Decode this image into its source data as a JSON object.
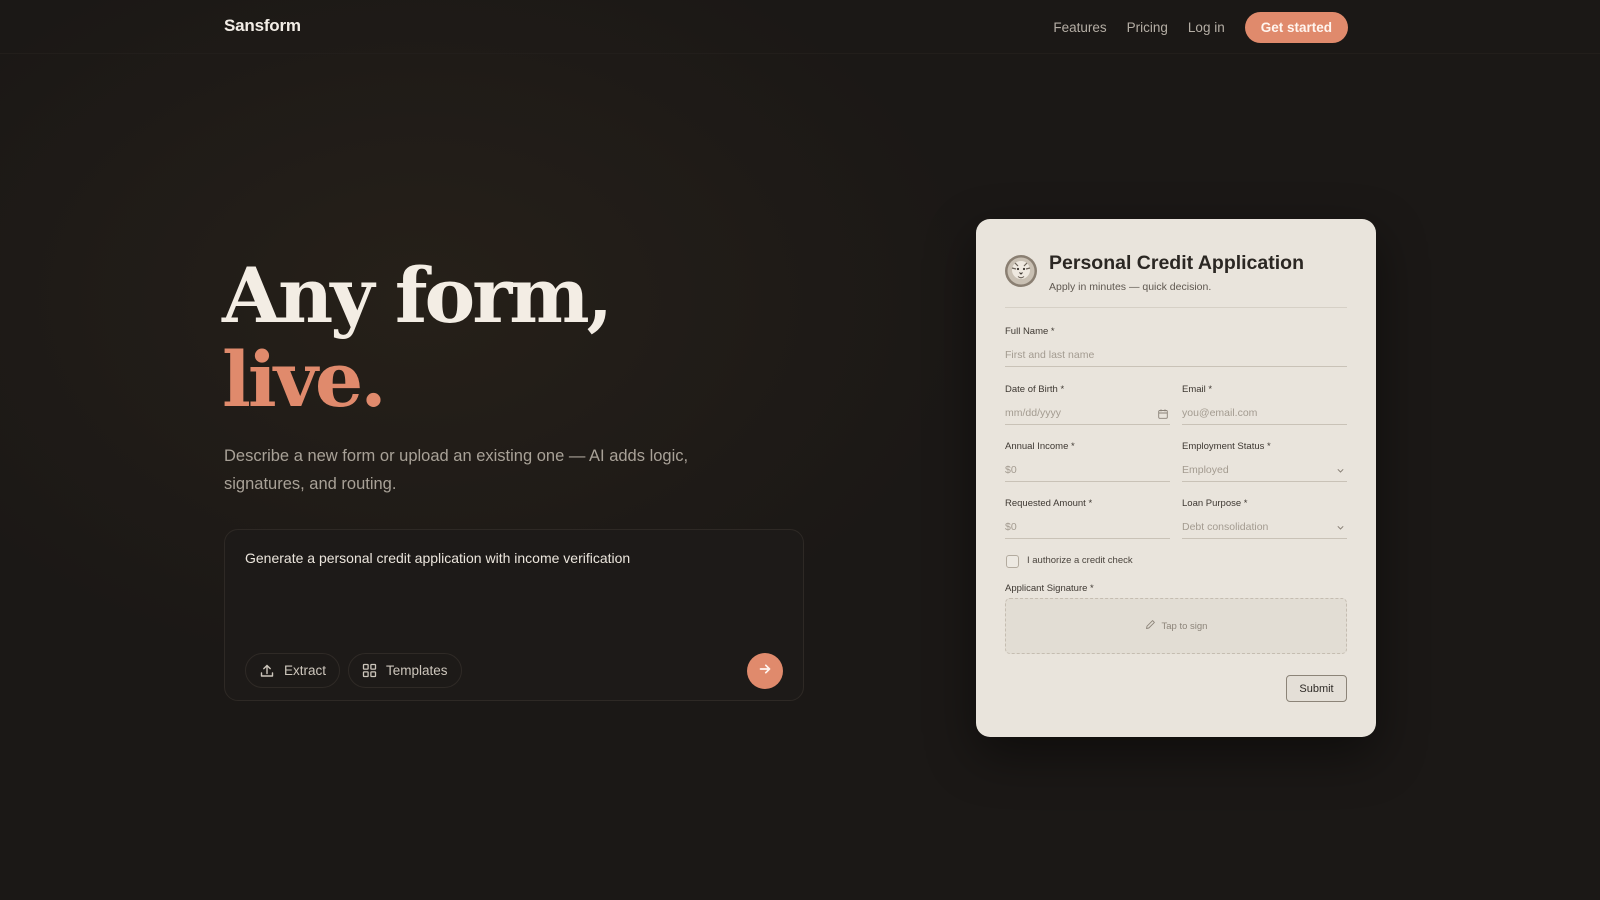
{
  "nav": {
    "brand": "Sansform",
    "links": [
      "Features",
      "Pricing",
      "Log in"
    ],
    "cta": "Get started"
  },
  "hero": {
    "title_line1": "Any form,",
    "title_line2": "live.",
    "subtitle": "Describe a new form or upload an existing one — AI adds logic, signatures, and routing."
  },
  "prompt": {
    "text": "Generate a personal credit application with income verification",
    "chips": [
      {
        "label": "Extract",
        "icon": "upload-icon"
      },
      {
        "label": "Templates",
        "icon": "grid-icon"
      }
    ],
    "send_icon": "arrow-right-icon"
  },
  "form": {
    "logo_icon": "lion-icon",
    "title": "Personal Credit Application",
    "subtitle": "Apply in minutes — quick decision.",
    "fields": {
      "full_name": {
        "label": "Full Name *",
        "placeholder": "First and last name"
      },
      "dob": {
        "label": "Date of Birth *",
        "placeholder": "mm/dd/yyyy"
      },
      "email": {
        "label": "Email *",
        "placeholder": "you@email.com"
      },
      "income": {
        "label": "Annual Income *",
        "placeholder": "$0"
      },
      "employment": {
        "label": "Employment Status *",
        "value": "Employed"
      },
      "amount": {
        "label": "Requested Amount *",
        "placeholder": "$0"
      },
      "purpose": {
        "label": "Loan Purpose *",
        "value": "Debt consolidation"
      }
    },
    "checkbox_label": "I authorize a credit check",
    "signature_label": "Applicant Signature *",
    "signature_hint": "Tap to sign",
    "submit": "Submit"
  },
  "colors": {
    "accent": "#e08a6c",
    "background": "#1b1816",
    "card": "#e9e4dc"
  }
}
